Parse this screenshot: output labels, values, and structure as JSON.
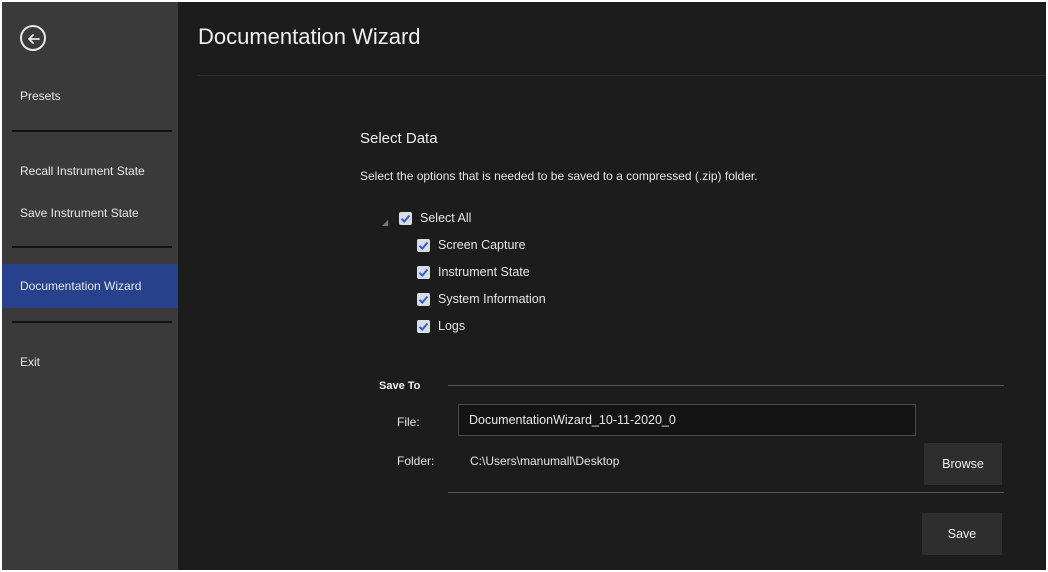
{
  "sidebar": {
    "items": [
      {
        "label": "Presets"
      },
      {
        "label": "Recall Instrument State"
      },
      {
        "label": "Save Instrument State"
      },
      {
        "label": "Documentation Wizard"
      },
      {
        "label": "Exit"
      }
    ],
    "active_index": 3
  },
  "header": {
    "title": "Documentation Wizard"
  },
  "select_data": {
    "title": "Select Data",
    "description": "Select the options that is needed to be saved to a compressed (.zip) folder.",
    "select_all": {
      "label": "Select All",
      "checked": true
    },
    "options": [
      {
        "label": "Screen Capture",
        "checked": true
      },
      {
        "label": "Instrument State",
        "checked": true
      },
      {
        "label": "System Information",
        "checked": true
      },
      {
        "label": "Logs",
        "checked": true
      }
    ]
  },
  "save_to": {
    "title": "Save To",
    "file_label": "File:",
    "file_value": "DocumentationWizard_10-11-2020_0",
    "folder_label": "Folder:",
    "folder_value": "C:\\Users\\manumall\\Desktop",
    "browse_label": "Browse",
    "save_label": "Save"
  },
  "icons": {
    "back": "back-arrow-circle-icon",
    "tree_toggle": "tree-expand-triangle-icon",
    "checkbox": "checkmark-icon"
  },
  "colors": {
    "accent": "#27418c",
    "sidebar_bg": "#3a3a3a",
    "main_bg": "#1c1c1c",
    "check": "#2f5fcf"
  }
}
